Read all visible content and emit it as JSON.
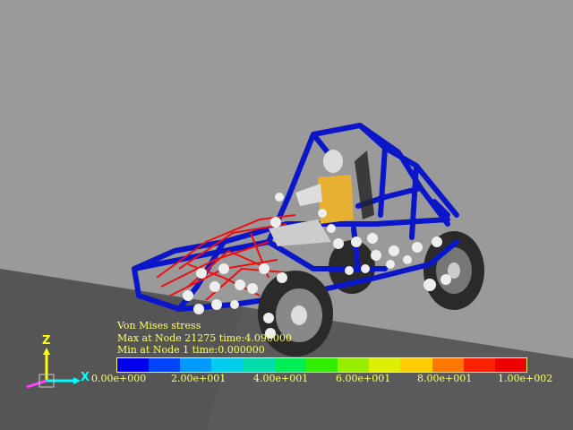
{
  "legend": {
    "title": "Von Mises stress",
    "max_line": "Max at Node 21275 time:4.090000",
    "min_line": "Min at Node 1 time:0.000000",
    "ticks": [
      "0.00e+000",
      "2.00e+001",
      "4.00e+001",
      "6.00e+001",
      "8.00e+001",
      "1.00e+002"
    ],
    "colors": [
      "#0000ee",
      "#0044ff",
      "#0099ff",
      "#00ccee",
      "#00ddaa",
      "#00ee55",
      "#33ee00",
      "#99ee00",
      "#ddee00",
      "#ffcc00",
      "#ff7700",
      "#ff2200",
      "#ee0000"
    ]
  },
  "axes": {
    "z_label": "Z",
    "x_label": "X",
    "z_color": "#ffff00",
    "x_color": "#00ffff",
    "y_color": "#ff44ff"
  },
  "scene": {
    "background": "#9a9a9a",
    "ground": "#5a5a5a",
    "frame_color": "#0a16c8",
    "stress_color": "#ee1010",
    "node_color": "#eeeeee",
    "driver_color": "#e8b030",
    "tire_color": "#2a2a2a"
  }
}
